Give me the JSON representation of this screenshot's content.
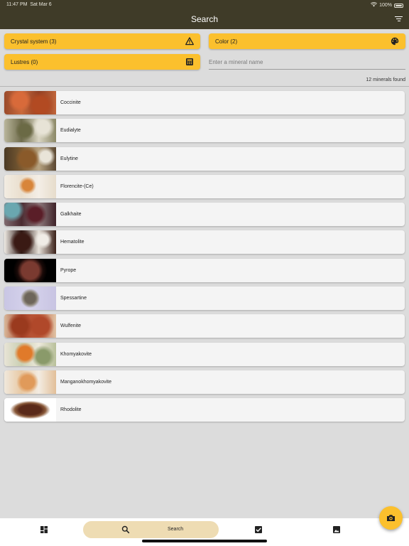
{
  "status": {
    "time": "11:47 PM",
    "date": "Sat Mar 6",
    "battery": "100%"
  },
  "appbar": {
    "title": "Search",
    "filter_icon": "filter-list-icon"
  },
  "filters": {
    "crystal_system": "Crystal system (3)",
    "color": "Color (2)",
    "lustres": "Lustres (0)"
  },
  "search": {
    "placeholder": "Enter a mineral name",
    "value": ""
  },
  "results_count": "12 minerals found",
  "minerals": [
    {
      "name": "Coccinite"
    },
    {
      "name": "Eudialyte"
    },
    {
      "name": "Eulytine"
    },
    {
      "name": "Florencite-(Ce)"
    },
    {
      "name": "Galkhaite"
    },
    {
      "name": "Hematolite"
    },
    {
      "name": "Pyrope"
    },
    {
      "name": "Spessartine"
    },
    {
      "name": "Wulfenite"
    },
    {
      "name": "Khomyakovite"
    },
    {
      "name": "Manganokhomyakovite"
    },
    {
      "name": "Rhodolite"
    }
  ],
  "bottom_nav": {
    "search_label": "Search",
    "items": [
      "dashboard-icon",
      "search-icon",
      "checklist-icon",
      "image-icon"
    ]
  },
  "colors": {
    "appbar": "#3f3b28",
    "accent": "#fbc02d",
    "pill": "#eedcb3"
  }
}
